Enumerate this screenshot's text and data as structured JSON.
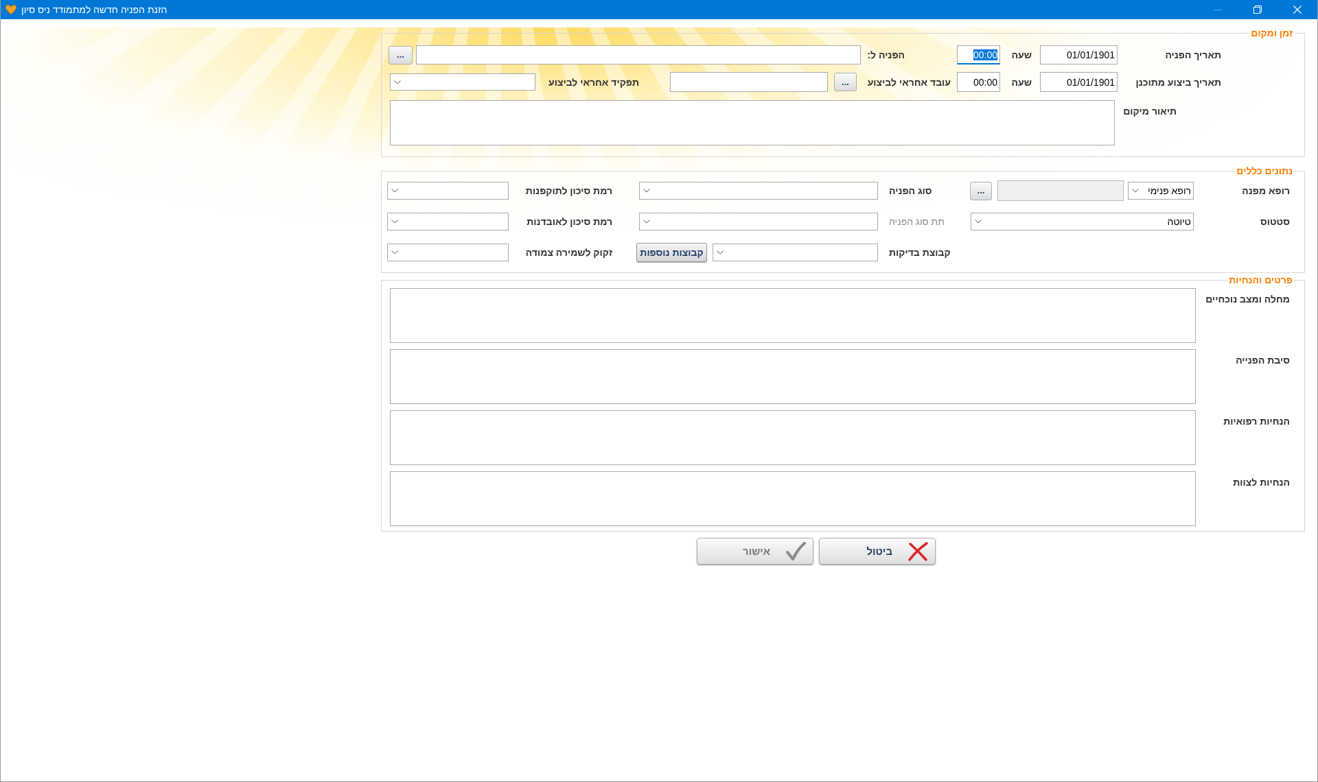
{
  "window": {
    "title": "הזנת הפניה חדשה למתמודד ניס סיון"
  },
  "groups": [
    {
      "title": "זמן ומקום",
      "rows": [
        [
          {
            "kind": "label",
            "text": "תאריך הפניה",
            "disabled": false
          },
          {
            "kind": "date",
            "value": "01/01/1901"
          },
          {
            "kind": "label",
            "text": "שעה",
            "disabled": false
          },
          {
            "kind": "time",
            "value": "00:00",
            "focused": true
          },
          {
            "kind": "label",
            "text": "הפניה ל:",
            "disabled": false
          },
          {
            "kind": "text",
            "disabled": false
          },
          {
            "kind": "ellipsis",
            "label": "..."
          }
        ],
        [
          {
            "kind": "label",
            "text": "תאריך ביצוע מתוכנן",
            "disabled": false
          },
          {
            "kind": "date",
            "value": "01/01/1901"
          },
          {
            "kind": "label",
            "text": "שעה",
            "disabled": false
          },
          {
            "kind": "time",
            "value": "00:00",
            "focused": false
          },
          {
            "kind": "label",
            "text": "עובד אחראי לביצוע",
            "disabled": false
          },
          {
            "kind": "ellipsis",
            "label": "..."
          },
          {
            "kind": "text",
            "disabled": false
          },
          {
            "kind": "label",
            "text": "תפקיד אחראי לביצוע",
            "disabled": false
          },
          {
            "kind": "dropdown"
          }
        ],
        [
          {
            "kind": "label",
            "text": "תיאור מיקום",
            "disabled": false
          },
          {
            "kind": "textarea"
          }
        ]
      ]
    },
    {
      "title": "נתונים כללים",
      "columns": [
        [
          [
            {
              "kind": "label",
              "text": "רופא מפנה",
              "disabled": false
            },
            {
              "kind": "dropdown",
              "value": "רופא פנימי"
            },
            {
              "kind": "text",
              "disabled": true
            },
            {
              "kind": "ellipsis",
              "label": "..."
            }
          ],
          [
            {
              "kind": "label",
              "text": "סטטוס",
              "disabled": false
            },
            {
              "kind": "dropdown",
              "value": "טיוטה"
            }
          ]
        ],
        [
          [
            {
              "kind": "label",
              "text": "סוג הפניה",
              "disabled": false
            },
            {
              "kind": "dropdown"
            }
          ],
          [
            {
              "kind": "label",
              "text": "תת סוג הפניה",
              "disabled": true
            },
            {
              "kind": "dropdown"
            }
          ],
          [
            {
              "kind": "label",
              "text": "קבוצת בדיקות",
              "disabled": false
            },
            {
              "kind": "dropdown"
            },
            {
              "kind": "button",
              "label": "קבוצות נוספות"
            }
          ]
        ],
        [
          [
            {
              "kind": "label",
              "text": "רמת סיכון לתוקפנות",
              "disabled": false
            },
            {
              "kind": "dropdown"
            }
          ],
          [
            {
              "kind": "label",
              "text": "רמת סיכון לאובדנות",
              "disabled": false
            },
            {
              "kind": "dropdown"
            }
          ],
          [
            {
              "kind": "label",
              "text": "זקוק לשמירה צמודה",
              "disabled": false
            },
            {
              "kind": "dropdown"
            }
          ]
        ]
      ]
    },
    {
      "title": "פרטים והנחיות",
      "rows": [
        [
          {
            "kind": "label",
            "text": "מחלה ומצב נוכחיים",
            "disabled": false
          },
          {
            "kind": "textarea"
          }
        ],
        [
          {
            "kind": "label",
            "text": "סיבת הפנייה",
            "disabled": false
          },
          {
            "kind": "textarea"
          }
        ],
        [
          {
            "kind": "label",
            "text": "הנחיות רפואיות",
            "disabled": false
          },
          {
            "kind": "textarea"
          }
        ],
        [
          {
            "kind": "label",
            "text": "הנחיות לצוות",
            "disabled": false
          },
          {
            "kind": "textarea"
          }
        ]
      ]
    }
  ],
  "buttons": [
    {
      "kind": "cancel",
      "label": "ביטול",
      "disabled": false
    },
    {
      "kind": "ok",
      "label": "אישור",
      "disabled": true
    }
  ]
}
